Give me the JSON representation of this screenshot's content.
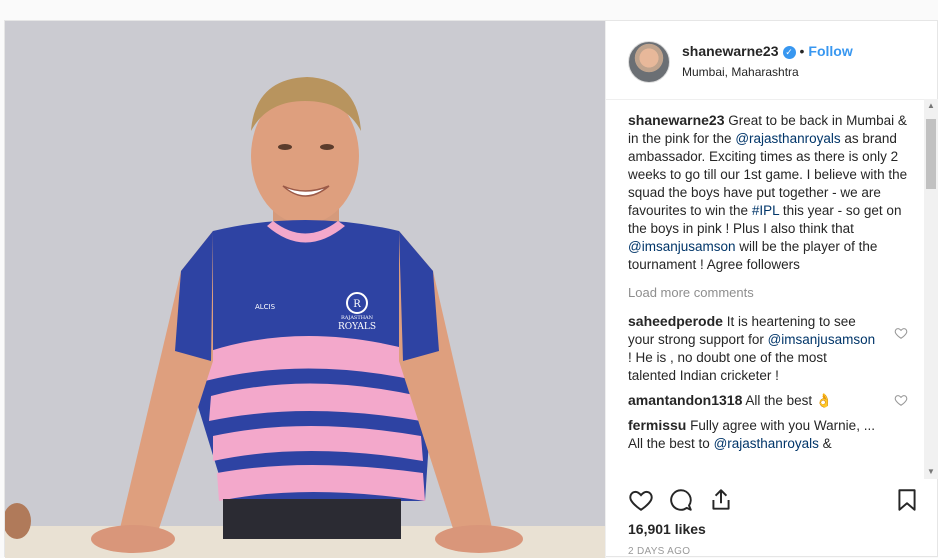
{
  "header": {
    "username": "shanewarne23",
    "verified_glyph": "✓",
    "separator": "•",
    "follow_label": "Follow",
    "location": "Mumbai, Maharashtra"
  },
  "caption": {
    "username": "shanewarne23",
    "text_1": "Great to be back in Mumbai & in the pink for the",
    "mention_1": "@rajasthanroyals",
    "text_2": "as brand ambassador. Exciting times as there is only 2 weeks to go till our 1st game. I believe with the squad the boys have put together - we are favourites to win the",
    "hashtag": "#IPL",
    "text_3": "this year - so get on the boys in pink ! Plus I also think that",
    "mention_2": "@imsanjusamson",
    "text_4": "will be the player of the tournament ! Agree followers"
  },
  "load_more": "Load more comments",
  "comments": [
    {
      "username": "saheedperode",
      "text_1": "It is heartening to see your strong support for",
      "mention": "@imsanjusamson",
      "text_2": "! He is , no doubt one of the most talented Indian cricketer !"
    },
    {
      "username": "amantandon1318",
      "text_1": "All the best 👌",
      "mention": "",
      "text_2": ""
    },
    {
      "username": "fermissu",
      "text_1": "Fully agree with you Warnie, ... All the best to",
      "mention": "@rajasthanroyals",
      "text_2": "&"
    }
  ],
  "photo": {
    "jersey_text": "ROYALS",
    "jersey_sub": "RAJASTHAN",
    "brand": "ALCIS"
  },
  "likes": "16,901 likes",
  "time_ago": "2 DAYS AGO",
  "icons": [
    "heart-icon",
    "comment-icon",
    "share-icon",
    "bookmark-icon",
    "verified-icon"
  ],
  "colors": {
    "accent": "#3897f0",
    "jersey_blue": "#2b3f9e",
    "jersey_pink": "#f2a3c6"
  }
}
